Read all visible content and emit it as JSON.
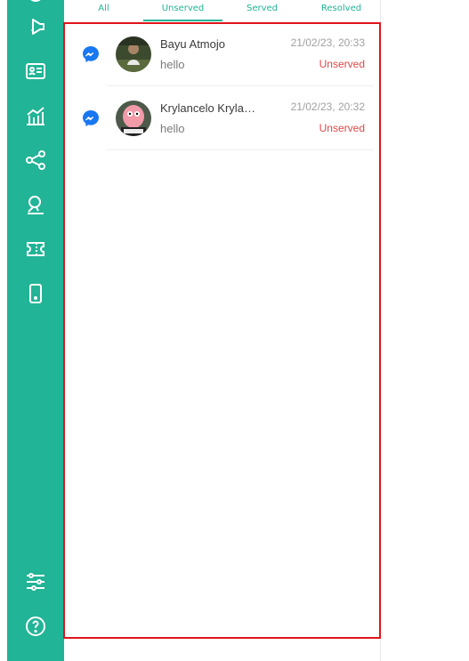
{
  "tabs": [
    {
      "label": "All",
      "active": false
    },
    {
      "label": "Unserved",
      "active": true
    },
    {
      "label": "Served",
      "active": false
    },
    {
      "label": "Resolved",
      "active": false
    }
  ],
  "sidebar": {
    "icons": [
      "megaphone-icon",
      "contact-card-icon",
      "analytics-icon",
      "share-nodes-icon",
      "agent-icon",
      "ticket-icon",
      "mobile-icon",
      "settings-sliders-icon",
      "help-icon"
    ]
  },
  "conversations": [
    {
      "name": "Bayu Atmojo",
      "preview": "hello",
      "time": "21/02/23, 20:33",
      "status": "Unserved",
      "channel": "messenger-icon"
    },
    {
      "name": "Krylancelo Krylancelo",
      "preview": "hello",
      "time": "21/02/23, 20:32",
      "status": "Unserved",
      "channel": "messenger-icon"
    }
  ],
  "colors": {
    "brand": "#21b496",
    "status_unserved": "#e04848",
    "messenger": "#1877f2",
    "highlight_border": "#e0151b"
  }
}
